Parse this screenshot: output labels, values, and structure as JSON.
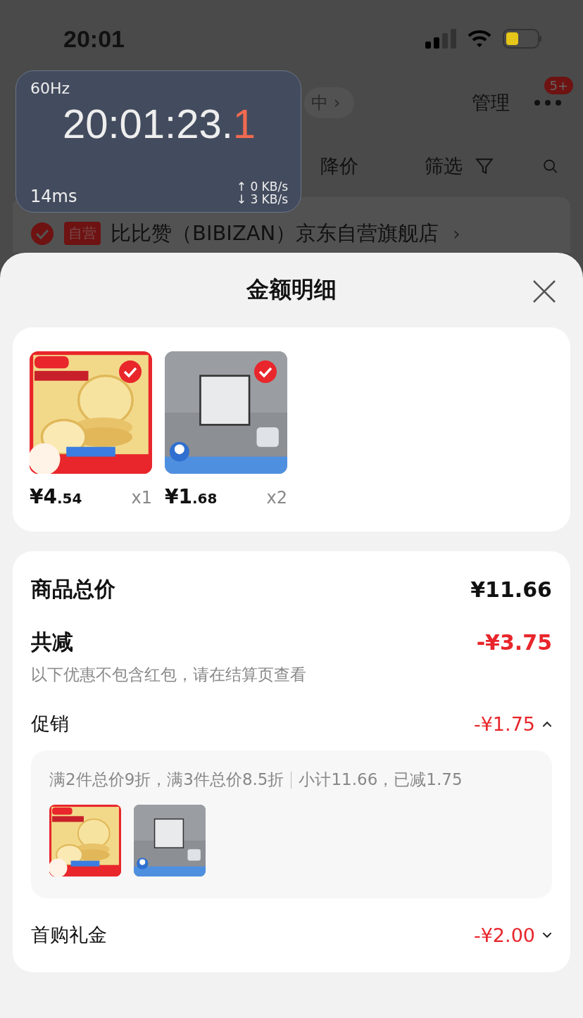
{
  "status_bar": {
    "time": "20:01"
  },
  "overlay_widget": {
    "refresh_rate": "60Hz",
    "clock": "20:01:23.",
    "clock_fraction": "1",
    "latency": "14ms",
    "upload": "↑ 0 KB/s",
    "download": "↓ 3 KB/s"
  },
  "background_page": {
    "breadcrumb": "中 ›",
    "manage": "管理",
    "more_badge": "5+",
    "filters": [
      {
        "label": "降价",
        "kind": "text"
      },
      {
        "label": "筛选",
        "kind": "filter"
      }
    ],
    "store": {
      "checked": true,
      "tag": "自营",
      "name": "比比赞（BIBIZAN）京东自营旗舰店",
      "chevron": "›"
    }
  },
  "sheet": {
    "title": "金额明细",
    "products": [
      {
        "kind": "picture",
        "selected": true,
        "price": "¥4.54",
        "qty": "x1"
      },
      {
        "kind": "picture",
        "selected": true,
        "price": "¥1.68",
        "qty": "x2"
      }
    ],
    "summary": {
      "total_label": "商品总价",
      "total": "¥11.66",
      "reduction_label": "共减",
      "reduction": "-¥3.75",
      "note": "以下优惠不包含红包，请在结算页查看",
      "sections": [
        {
          "label": "促销",
          "amount": "-¥1.75",
          "expanded": true,
          "rule": "满2件总价9折，满3件总价8.5折",
          "subtotal": "小计11.66，已减1.75"
        },
        {
          "label": "首购礼金",
          "amount": "-¥2.00",
          "expanded": false
        }
      ]
    }
  }
}
